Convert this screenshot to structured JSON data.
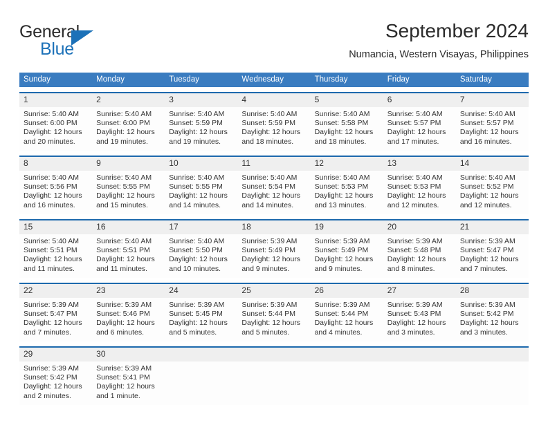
{
  "brand": {
    "name_part1": "General",
    "name_part2": "Blue",
    "accent_color": "#1c71b8"
  },
  "header": {
    "title": "September 2024",
    "subtitle": "Numancia, Western Visayas, Philippines"
  },
  "theme": {
    "header_bg": "#3a7cc0",
    "row_divider": "#1d69ad",
    "daynum_bg": "#efefef"
  },
  "weekdays": [
    "Sunday",
    "Monday",
    "Tuesday",
    "Wednesday",
    "Thursday",
    "Friday",
    "Saturday"
  ],
  "weeks": [
    [
      {
        "day": "1",
        "sunrise": "Sunrise: 5:40 AM",
        "sunset": "Sunset: 6:00 PM",
        "daylight1": "Daylight: 12 hours",
        "daylight2": "and 20 minutes."
      },
      {
        "day": "2",
        "sunrise": "Sunrise: 5:40 AM",
        "sunset": "Sunset: 6:00 PM",
        "daylight1": "Daylight: 12 hours",
        "daylight2": "and 19 minutes."
      },
      {
        "day": "3",
        "sunrise": "Sunrise: 5:40 AM",
        "sunset": "Sunset: 5:59 PM",
        "daylight1": "Daylight: 12 hours",
        "daylight2": "and 19 minutes."
      },
      {
        "day": "4",
        "sunrise": "Sunrise: 5:40 AM",
        "sunset": "Sunset: 5:59 PM",
        "daylight1": "Daylight: 12 hours",
        "daylight2": "and 18 minutes."
      },
      {
        "day": "5",
        "sunrise": "Sunrise: 5:40 AM",
        "sunset": "Sunset: 5:58 PM",
        "daylight1": "Daylight: 12 hours",
        "daylight2": "and 18 minutes."
      },
      {
        "day": "6",
        "sunrise": "Sunrise: 5:40 AM",
        "sunset": "Sunset: 5:57 PM",
        "daylight1": "Daylight: 12 hours",
        "daylight2": "and 17 minutes."
      },
      {
        "day": "7",
        "sunrise": "Sunrise: 5:40 AM",
        "sunset": "Sunset: 5:57 PM",
        "daylight1": "Daylight: 12 hours",
        "daylight2": "and 16 minutes."
      }
    ],
    [
      {
        "day": "8",
        "sunrise": "Sunrise: 5:40 AM",
        "sunset": "Sunset: 5:56 PM",
        "daylight1": "Daylight: 12 hours",
        "daylight2": "and 16 minutes."
      },
      {
        "day": "9",
        "sunrise": "Sunrise: 5:40 AM",
        "sunset": "Sunset: 5:55 PM",
        "daylight1": "Daylight: 12 hours",
        "daylight2": "and 15 minutes."
      },
      {
        "day": "10",
        "sunrise": "Sunrise: 5:40 AM",
        "sunset": "Sunset: 5:55 PM",
        "daylight1": "Daylight: 12 hours",
        "daylight2": "and 14 minutes."
      },
      {
        "day": "11",
        "sunrise": "Sunrise: 5:40 AM",
        "sunset": "Sunset: 5:54 PM",
        "daylight1": "Daylight: 12 hours",
        "daylight2": "and 14 minutes."
      },
      {
        "day": "12",
        "sunrise": "Sunrise: 5:40 AM",
        "sunset": "Sunset: 5:53 PM",
        "daylight1": "Daylight: 12 hours",
        "daylight2": "and 13 minutes."
      },
      {
        "day": "13",
        "sunrise": "Sunrise: 5:40 AM",
        "sunset": "Sunset: 5:53 PM",
        "daylight1": "Daylight: 12 hours",
        "daylight2": "and 12 minutes."
      },
      {
        "day": "14",
        "sunrise": "Sunrise: 5:40 AM",
        "sunset": "Sunset: 5:52 PM",
        "daylight1": "Daylight: 12 hours",
        "daylight2": "and 12 minutes."
      }
    ],
    [
      {
        "day": "15",
        "sunrise": "Sunrise: 5:40 AM",
        "sunset": "Sunset: 5:51 PM",
        "daylight1": "Daylight: 12 hours",
        "daylight2": "and 11 minutes."
      },
      {
        "day": "16",
        "sunrise": "Sunrise: 5:40 AM",
        "sunset": "Sunset: 5:51 PM",
        "daylight1": "Daylight: 12 hours",
        "daylight2": "and 11 minutes."
      },
      {
        "day": "17",
        "sunrise": "Sunrise: 5:40 AM",
        "sunset": "Sunset: 5:50 PM",
        "daylight1": "Daylight: 12 hours",
        "daylight2": "and 10 minutes."
      },
      {
        "day": "18",
        "sunrise": "Sunrise: 5:39 AM",
        "sunset": "Sunset: 5:49 PM",
        "daylight1": "Daylight: 12 hours",
        "daylight2": "and 9 minutes."
      },
      {
        "day": "19",
        "sunrise": "Sunrise: 5:39 AM",
        "sunset": "Sunset: 5:49 PM",
        "daylight1": "Daylight: 12 hours",
        "daylight2": "and 9 minutes."
      },
      {
        "day": "20",
        "sunrise": "Sunrise: 5:39 AM",
        "sunset": "Sunset: 5:48 PM",
        "daylight1": "Daylight: 12 hours",
        "daylight2": "and 8 minutes."
      },
      {
        "day": "21",
        "sunrise": "Sunrise: 5:39 AM",
        "sunset": "Sunset: 5:47 PM",
        "daylight1": "Daylight: 12 hours",
        "daylight2": "and 7 minutes."
      }
    ],
    [
      {
        "day": "22",
        "sunrise": "Sunrise: 5:39 AM",
        "sunset": "Sunset: 5:47 PM",
        "daylight1": "Daylight: 12 hours",
        "daylight2": "and 7 minutes."
      },
      {
        "day": "23",
        "sunrise": "Sunrise: 5:39 AM",
        "sunset": "Sunset: 5:46 PM",
        "daylight1": "Daylight: 12 hours",
        "daylight2": "and 6 minutes."
      },
      {
        "day": "24",
        "sunrise": "Sunrise: 5:39 AM",
        "sunset": "Sunset: 5:45 PM",
        "daylight1": "Daylight: 12 hours",
        "daylight2": "and 5 minutes."
      },
      {
        "day": "25",
        "sunrise": "Sunrise: 5:39 AM",
        "sunset": "Sunset: 5:44 PM",
        "daylight1": "Daylight: 12 hours",
        "daylight2": "and 5 minutes."
      },
      {
        "day": "26",
        "sunrise": "Sunrise: 5:39 AM",
        "sunset": "Sunset: 5:44 PM",
        "daylight1": "Daylight: 12 hours",
        "daylight2": "and 4 minutes."
      },
      {
        "day": "27",
        "sunrise": "Sunrise: 5:39 AM",
        "sunset": "Sunset: 5:43 PM",
        "daylight1": "Daylight: 12 hours",
        "daylight2": "and 3 minutes."
      },
      {
        "day": "28",
        "sunrise": "Sunrise: 5:39 AM",
        "sunset": "Sunset: 5:42 PM",
        "daylight1": "Daylight: 12 hours",
        "daylight2": "and 3 minutes."
      }
    ],
    [
      {
        "day": "29",
        "sunrise": "Sunrise: 5:39 AM",
        "sunset": "Sunset: 5:42 PM",
        "daylight1": "Daylight: 12 hours",
        "daylight2": "and 2 minutes."
      },
      {
        "day": "30",
        "sunrise": "Sunrise: 5:39 AM",
        "sunset": "Sunset: 5:41 PM",
        "daylight1": "Daylight: 12 hours",
        "daylight2": "and 1 minute."
      },
      {
        "day": "",
        "sunrise": "",
        "sunset": "",
        "daylight1": "",
        "daylight2": ""
      },
      {
        "day": "",
        "sunrise": "",
        "sunset": "",
        "daylight1": "",
        "daylight2": ""
      },
      {
        "day": "",
        "sunrise": "",
        "sunset": "",
        "daylight1": "",
        "daylight2": ""
      },
      {
        "day": "",
        "sunrise": "",
        "sunset": "",
        "daylight1": "",
        "daylight2": ""
      },
      {
        "day": "",
        "sunrise": "",
        "sunset": "",
        "daylight1": "",
        "daylight2": ""
      }
    ]
  ]
}
